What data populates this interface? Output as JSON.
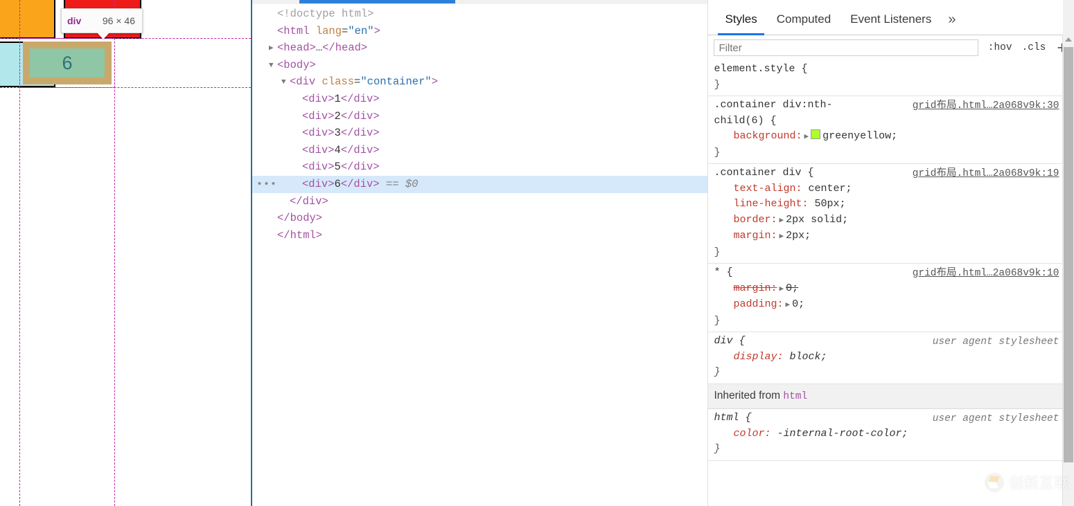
{
  "page": {
    "cells": [
      {
        "label": "",
        "color_name": "orange",
        "color": "#f9a41b"
      },
      {
        "label": "",
        "color_name": "cyan",
        "color": "#b2e8ec"
      },
      {
        "label": "",
        "color_name": "red",
        "color": "#ee1b18"
      }
    ],
    "highlighted_cell": {
      "label": "6",
      "content_color": "#8fc6a5",
      "padding_color": "#c9a96b",
      "margin_outline_color": "#c026a3"
    },
    "inspector_tooltip": {
      "tag": "div",
      "dimensions": "96 × 46"
    }
  },
  "devtools": {
    "dom": {
      "lines": [
        {
          "indent": 0,
          "twisty": "",
          "html": "<span class=\"comment\">&lt;!doctype html&gt;</span>",
          "selected": false,
          "dots": false
        },
        {
          "indent": 0,
          "twisty": "",
          "html": "<span class=\"tag\">&lt;html</span> <span class=\"attrname\">lang</span>=<span class=\"attrval\">\"en\"</span><span class=\"tag\">&gt;</span>",
          "selected": false,
          "dots": false
        },
        {
          "indent": 0,
          "twisty": "▶",
          "html": "<span class=\"tag\">&lt;head&gt;</span><span class=\"txt\">…</span><span class=\"tag\">&lt;/head&gt;</span>",
          "selected": false,
          "dots": false
        },
        {
          "indent": 0,
          "twisty": "▼",
          "html": "<span class=\"tag\">&lt;body&gt;</span>",
          "selected": false,
          "dots": false
        },
        {
          "indent": 1,
          "twisty": "▼",
          "html": "<span class=\"tag\">&lt;div</span> <span class=\"attrname\">class</span>=<span class=\"attrval\">\"container\"</span><span class=\"tag\">&gt;</span>",
          "selected": false,
          "dots": false
        },
        {
          "indent": 2,
          "twisty": "",
          "html": "<span class=\"tag\">&lt;div&gt;</span><span class=\"txt\">1</span><span class=\"tag\">&lt;/div&gt;</span>",
          "selected": false,
          "dots": false
        },
        {
          "indent": 2,
          "twisty": "",
          "html": "<span class=\"tag\">&lt;div&gt;</span><span class=\"txt\">2</span><span class=\"tag\">&lt;/div&gt;</span>",
          "selected": false,
          "dots": false
        },
        {
          "indent": 2,
          "twisty": "",
          "html": "<span class=\"tag\">&lt;div&gt;</span><span class=\"txt\">3</span><span class=\"tag\">&lt;/div&gt;</span>",
          "selected": false,
          "dots": false
        },
        {
          "indent": 2,
          "twisty": "",
          "html": "<span class=\"tag\">&lt;div&gt;</span><span class=\"txt\">4</span><span class=\"tag\">&lt;/div&gt;</span>",
          "selected": false,
          "dots": false
        },
        {
          "indent": 2,
          "twisty": "",
          "html": "<span class=\"tag\">&lt;div&gt;</span><span class=\"txt\">5</span><span class=\"tag\">&lt;/div&gt;</span>",
          "selected": false,
          "dots": false
        },
        {
          "indent": 2,
          "twisty": "",
          "html": "<span class=\"tag\">&lt;div&gt;</span><span class=\"txt\">6</span><span class=\"tag\">&lt;/div&gt;</span> <span class=\"dollar\">== $0</span>",
          "selected": true,
          "dots": true
        },
        {
          "indent": 1,
          "twisty": "",
          "html": "<span class=\"tag\">&lt;/div&gt;</span>",
          "selected": false,
          "dots": false
        },
        {
          "indent": 0,
          "twisty": "",
          "html": "<span class=\"tag\">&lt;/body&gt;</span>",
          "selected": false,
          "dots": false
        },
        {
          "indent": 0,
          "twisty": "",
          "html": "<span class=\"tag\">&lt;/html&gt;</span>",
          "selected": false,
          "dots": false
        }
      ]
    },
    "styles": {
      "tabs": [
        {
          "label": "Styles",
          "active": true
        },
        {
          "label": "Computed",
          "active": false
        },
        {
          "label": "Event Listeners",
          "active": false
        }
      ],
      "more_tabs_icon": "»",
      "filter_placeholder": "Filter",
      "filter_value": "",
      "hov_button": ":hov",
      "cls_button": ".cls",
      "add_rule_button": "+",
      "rules": [
        {
          "selector": "element.style {",
          "close": "}",
          "source": "",
          "ua": false,
          "declarations": []
        },
        {
          "selector": ".container div:nth-child(6) {",
          "close": "}",
          "source": "grid布局.html…2a068v9k:30",
          "ua": false,
          "declarations": [
            {
              "prop": "background",
              "value": "greenyellow;",
              "expandable": true,
              "swatch": "#adff2f",
              "struck": false
            }
          ]
        },
        {
          "selector": ".container div {",
          "close": "}",
          "source": "grid布局.html…2a068v9k:19",
          "ua": false,
          "declarations": [
            {
              "prop": "text-align",
              "value": "center;",
              "expandable": false,
              "swatch": "",
              "struck": false
            },
            {
              "prop": "line-height",
              "value": "50px;",
              "expandable": false,
              "swatch": "",
              "struck": false
            },
            {
              "prop": "border",
              "value": "2px solid;",
              "expandable": true,
              "swatch": "",
              "struck": false
            },
            {
              "prop": "margin",
              "value": "2px;",
              "expandable": true,
              "swatch": "",
              "struck": false
            }
          ]
        },
        {
          "selector": "* {",
          "close": "}",
          "source": "grid布局.html…2a068v9k:10",
          "ua": false,
          "declarations": [
            {
              "prop": "margin",
              "value": "0;",
              "expandable": true,
              "swatch": "",
              "struck": true
            },
            {
              "prop": "padding",
              "value": "0;",
              "expandable": true,
              "swatch": "",
              "struck": false
            }
          ]
        },
        {
          "selector": "div {",
          "close": "}",
          "source": "user agent stylesheet",
          "ua": true,
          "declarations": [
            {
              "prop": "display",
              "value": "block;",
              "expandable": false,
              "swatch": "",
              "struck": false
            }
          ]
        }
      ],
      "inherited_label": "Inherited from",
      "inherited_from": "html",
      "inherited_rules": [
        {
          "selector": "html {",
          "close": "}",
          "source": "user agent stylesheet",
          "ua": true,
          "declarations": [
            {
              "prop": "color",
              "value": "-internal-root-color;",
              "expandable": false,
              "swatch": "",
              "struck": false
            }
          ]
        }
      ]
    }
  },
  "watermark": {
    "text": "创新互联"
  }
}
